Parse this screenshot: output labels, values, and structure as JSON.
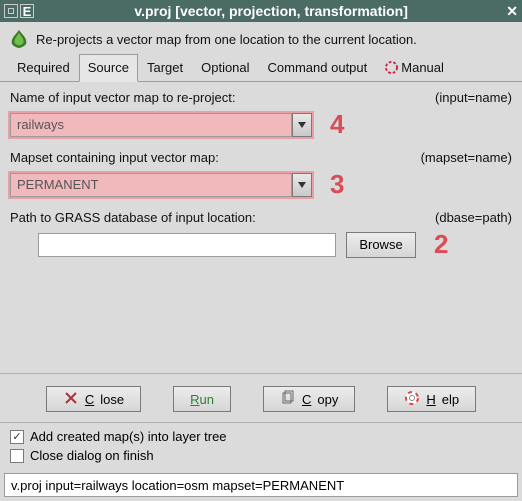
{
  "title": "v.proj [vector, projection, transformation]",
  "description": "Re-projects a vector map from one location to the current location.",
  "tabs": {
    "required": "Required",
    "source": "Source",
    "target": "Target",
    "optional": "Optional",
    "output": "Command output",
    "manual": "Manual"
  },
  "fields": {
    "input": {
      "label": "Name of input vector map to re-project:",
      "hint": "(input=name)",
      "value": "railways",
      "callout": "4"
    },
    "mapset": {
      "label": "Mapset containing input vector map:",
      "hint": "(mapset=name)",
      "value": "PERMANENT",
      "callout": "3"
    },
    "dbase": {
      "label": "Path to GRASS database of input location:",
      "hint": "(dbase=path)",
      "value": "",
      "browse": "Browse",
      "callout": "2"
    }
  },
  "buttons": {
    "close": "Close",
    "run": "Run",
    "copy": "Copy",
    "help": "Help"
  },
  "checks": {
    "addLayer": "Add created map(s) into layer tree",
    "closeDialog": "Close dialog on finish"
  },
  "command": "v.proj input=railways location=osm mapset=PERMANENT"
}
